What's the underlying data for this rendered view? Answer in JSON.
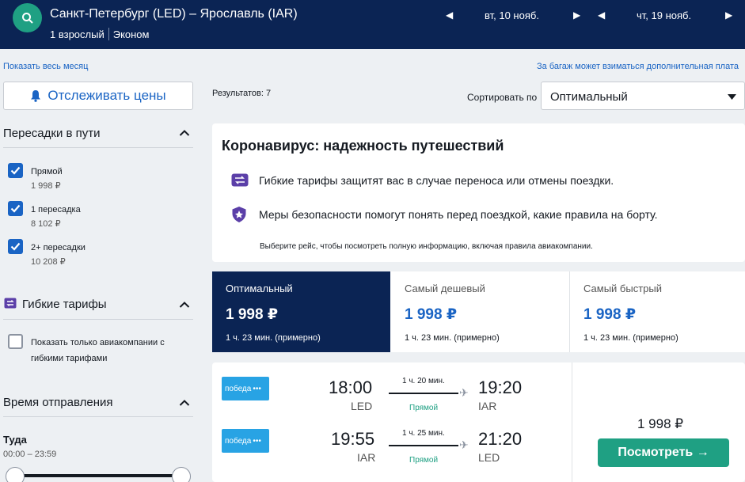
{
  "header": {
    "route": "Санкт-Петербург (LED) – Ярославль (IAR)",
    "passengers": "1 взрослый",
    "cabin": "Эконом",
    "depart_date": "вт, 10 нояб.",
    "return_date": "чт, 19 нояб."
  },
  "links": {
    "show_month": "Показать весь месяц",
    "baggage_note": "За багаж может взиматься дополнительная плата"
  },
  "sidebar": {
    "track_prices": "Отслеживать цены",
    "stops_title": "Пересадки в пути",
    "stops": [
      {
        "label": "Прямой",
        "price": "1 998 ₽",
        "checked": true
      },
      {
        "label": "1 пересадка",
        "price": "8 102 ₽",
        "checked": true
      },
      {
        "label": "2+ пересадки",
        "price": "10 208 ₽",
        "checked": true
      }
    ],
    "flex_title": "Гибкие тарифы",
    "flex_option_line1": "Показать только авиакомпании с",
    "flex_option_line2": "гибкими тарифами",
    "time_title": "Время отправления",
    "direction": "Туда",
    "time_range": "00:00 – 23:59"
  },
  "results": {
    "count": "Результатов: 7",
    "sort_label": "Сортировать по",
    "sort_value": "Оптимальный"
  },
  "covid": {
    "title": "Коронавирус: надежность путешествий",
    "line1": "Гибкие тарифы защитят вас в случае переноса или отмены поездки.",
    "line2": "Меры безопасности помогут понять перед поездкой, какие правила на борту.",
    "note": "Выберите рейс, чтобы посмотреть полную информацию, включая правила авиакомпании."
  },
  "tabs": [
    {
      "label": "Оптимальный",
      "price": "1 998 ₽",
      "duration": "1 ч. 23 мин. (примерно)",
      "active": true
    },
    {
      "label": "Самый дешевый",
      "price": "1 998 ₽",
      "duration": "1 ч. 23 мин. (примерно)",
      "active": false
    },
    {
      "label": "Самый быстрый",
      "price": "1 998 ₽",
      "duration": "1 ч. 23 мин. (примерно)",
      "active": false
    }
  ],
  "flight": {
    "airline": "победа",
    "outbound": {
      "dep_time": "18:00",
      "dep_code": "LED",
      "duration": "1 ч. 20 мин.",
      "stops": "Прямой",
      "arr_time": "19:20",
      "arr_code": "IAR"
    },
    "inbound": {
      "dep_time": "19:55",
      "dep_code": "IAR",
      "duration": "1 ч. 25 мин.",
      "stops": "Прямой",
      "arr_time": "21:20",
      "arr_code": "LED"
    },
    "price": "1 998 ₽",
    "view_button": "Посмотреть →"
  },
  "colors": {
    "header_bg": "#0b2454",
    "accent_green": "#1fa083",
    "link_blue": "#1a64c4",
    "airline_blue": "#28a3e4",
    "flex_purple": "#5b3fa8"
  }
}
